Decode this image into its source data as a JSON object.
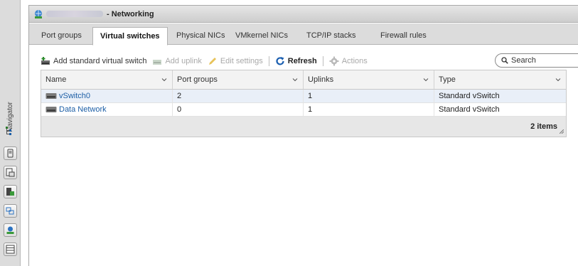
{
  "navigator": {
    "label": "Navigator",
    "rail_buttons": [
      "host-icon",
      "vm-icon",
      "storage-icon",
      "networking-icon",
      "monitor-icon",
      "list-icon"
    ]
  },
  "panel": {
    "title": "- Networking",
    "host_name_redacted": true
  },
  "tabs": [
    {
      "label": "Port groups",
      "active": false
    },
    {
      "label": "Virtual switches",
      "active": true
    },
    {
      "label": "Physical NICs",
      "active": false
    },
    {
      "label": "VMkernel NICs",
      "active": false
    },
    {
      "label": "TCP/IP stacks",
      "active": false
    },
    {
      "label": "Firewall rules",
      "active": false
    }
  ],
  "toolbar": {
    "add_switch": "Add standard virtual switch",
    "add_uplink": "Add uplink",
    "edit_settings": "Edit settings",
    "refresh": "Refresh",
    "actions": "Actions",
    "search_placeholder": "Search"
  },
  "table": {
    "columns": [
      "Name",
      "Port groups",
      "Uplinks",
      "Type"
    ],
    "rows": [
      {
        "name": "vSwitch0",
        "port_groups": "2",
        "uplinks": "1",
        "type": "Standard vSwitch"
      },
      {
        "name": "Data Network",
        "port_groups": "0",
        "uplinks": "1",
        "type": "Standard vSwitch"
      }
    ],
    "footer": "2 items"
  },
  "colors": {
    "link": "#1d5fa6",
    "row_alt": "#e9eff8",
    "refresh_icon": "#1b5fb0",
    "add_icon": "#2e8b2e"
  }
}
